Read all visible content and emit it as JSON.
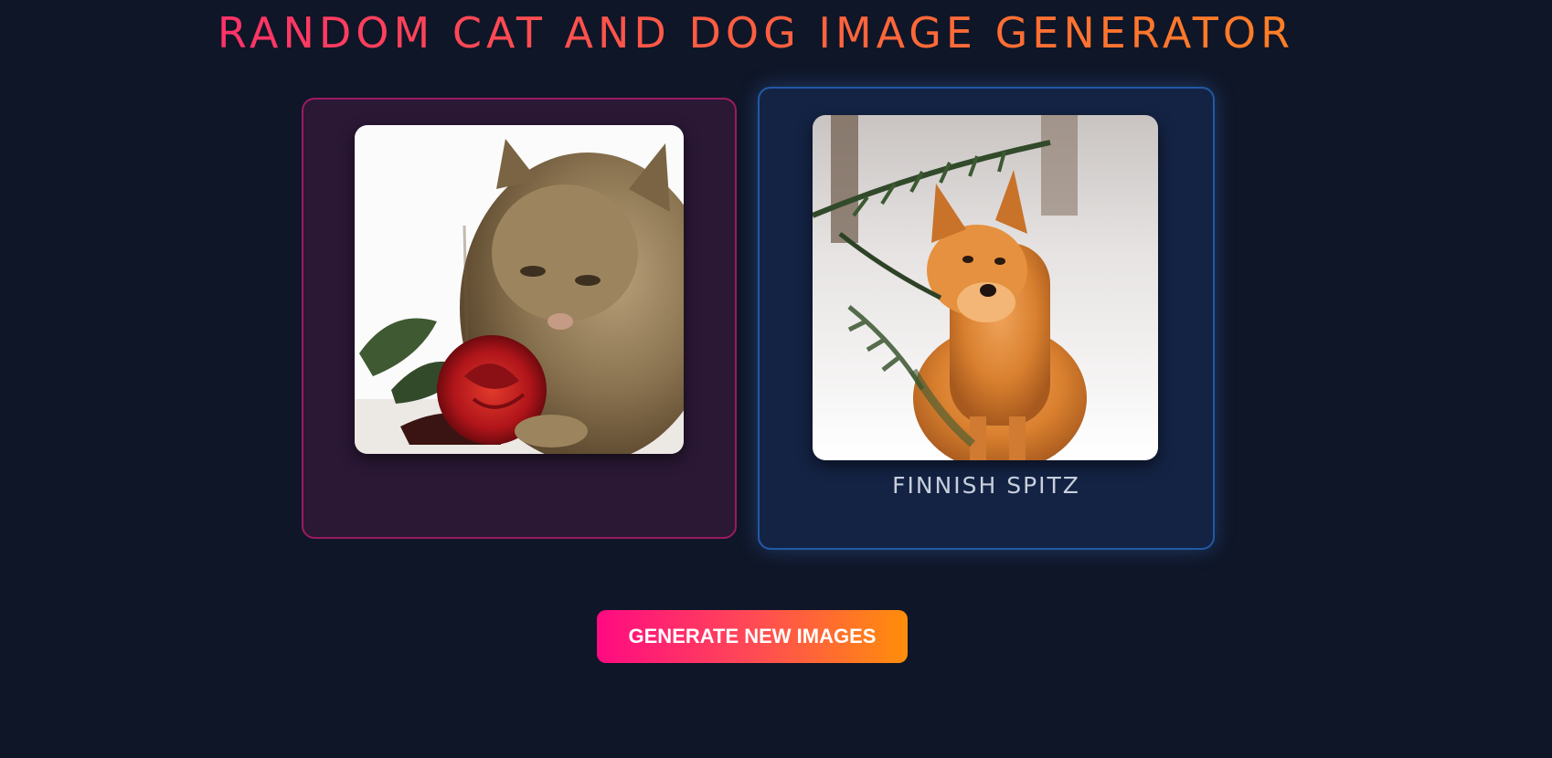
{
  "header": {
    "title": "RANDOM CAT AND DOG IMAGE GENERATOR"
  },
  "cat_card": {
    "image_subject": "kitten-with-red-rose",
    "accent_color": "#9c1a62"
  },
  "dog_card": {
    "image_subject": "finnish-spitz-in-snow",
    "breed_label": "FINNISH SPITZ",
    "accent_color": "#2159a6"
  },
  "actions": {
    "generate_label": "GENERATE NEW IMAGES"
  },
  "colors": {
    "background": "#0f1628",
    "title_gradient_start": "#ff1f7a",
    "title_gradient_end": "#ff8c1a",
    "button_gradient_start": "#ff0a82",
    "button_gradient_end": "#ff8e0a"
  }
}
